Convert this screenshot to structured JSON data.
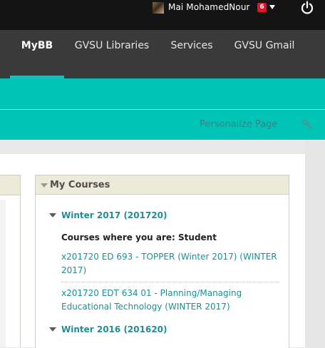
{
  "topbar": {
    "user_name": "Mai MohamedNour",
    "notification_count": "6",
    "icons": {
      "caret": "caret-down-icon",
      "power": "power-icon"
    }
  },
  "nav": {
    "tabs": [
      {
        "label": "MyBB",
        "active": true
      },
      {
        "label": "GVSU Libraries",
        "active": false
      },
      {
        "label": "Services",
        "active": false
      },
      {
        "label": "GVSU Gmail",
        "active": false
      }
    ]
  },
  "toolbar": {
    "personalize_label": "Personalize Page",
    "icon": "wrench-icon"
  },
  "courses_module": {
    "title": "My Courses",
    "terms": [
      {
        "title": "Winter 2017 (201720)",
        "role_heading": "Courses where you are: Student",
        "courses": [
          "x201720 ED 693 - TOPPER (Winter 2017) (WINTER 2017)",
          "x201720 EDT 634 01 - Planning/Managing Educational Technology (WINTER 2017)"
        ]
      },
      {
        "title": "Winter 2016 (201620)"
      }
    ]
  },
  "colors": {
    "topbar_bg": "#141414",
    "nav_bg": "#3a3a3a",
    "nav_active_underline": "#2bb5bd",
    "teal_band": "#00c4b6",
    "link": "#1c8f96",
    "badge": "#e8102a",
    "module_header_bg": "#ecebd9"
  }
}
